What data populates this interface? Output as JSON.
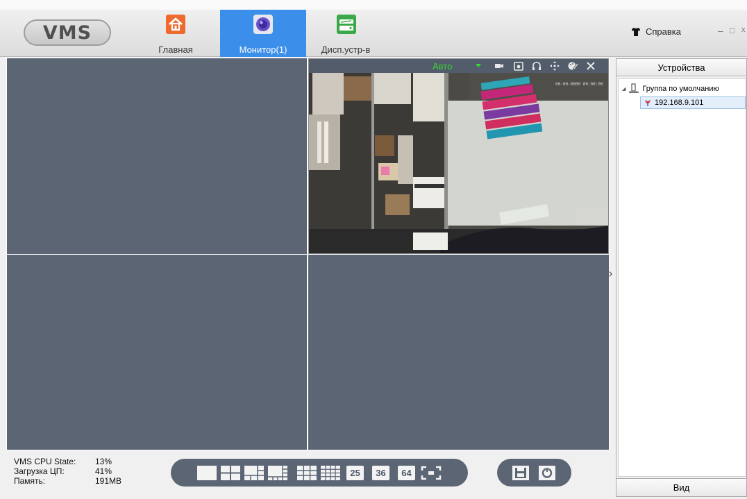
{
  "app": {
    "logo_text": "VMS"
  },
  "nav": {
    "tabs": [
      {
        "label": "Главная",
        "icon": "home-icon",
        "active": false
      },
      {
        "label": "Монитор(1)",
        "icon": "monitor-icon",
        "active": true
      },
      {
        "label": "Дисп.устр-в",
        "icon": "device-manager-icon",
        "active": false
      }
    ],
    "help_label": "Справка",
    "window_controls": [
      "–",
      "□",
      "x"
    ]
  },
  "video": {
    "mode_label": "Авто",
    "toolbar_icons": [
      "record-icon",
      "snapshot-icon",
      "audio-icon",
      "ptz-icon",
      "color-adjust-icon",
      "close-icon"
    ],
    "active_cell": 2
  },
  "devices_panel": {
    "title": "Устройства",
    "group_label": "Группа по умолчанию",
    "device_ip": "192.168.9.101",
    "footer_label": "Вид"
  },
  "stats": {
    "rows": [
      {
        "key": "VMS CPU State:",
        "value": "13%"
      },
      {
        "key": "Загрузка ЦП:",
        "value": "41%"
      },
      {
        "key": "Память:",
        "value": "191MB"
      }
    ]
  },
  "layout_bar": {
    "numbers": [
      "25",
      "36",
      "64"
    ]
  },
  "colors": {
    "accent": "#3b8eea",
    "cell_bg": "#5b6574",
    "mode_green": "#38d830"
  }
}
